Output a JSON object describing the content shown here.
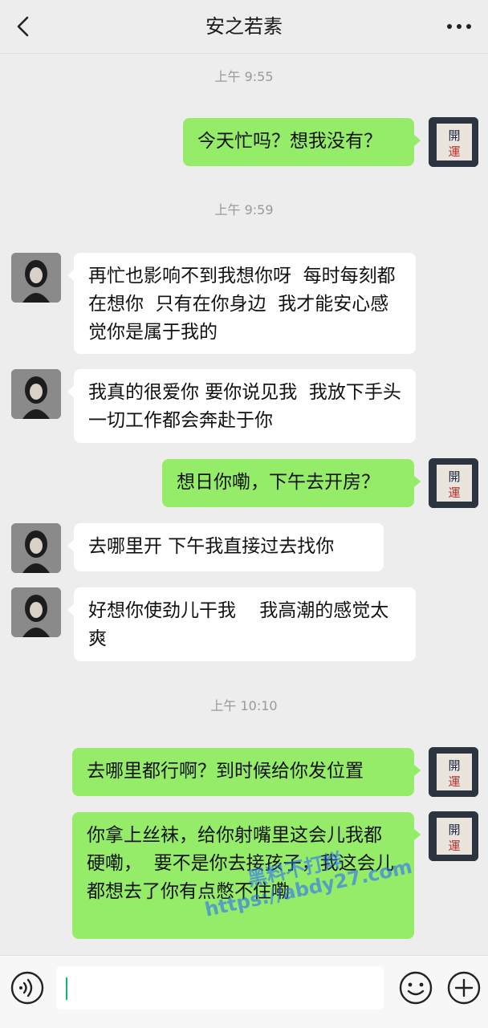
{
  "header": {
    "title": "安之若素",
    "back_icon": "chevron-left-icon",
    "more_icon": "more-dots-icon"
  },
  "messages": [
    {
      "type": "time",
      "text": "上午 9:55"
    },
    {
      "type": "msg",
      "side": "right",
      "text": "今天忙吗？想我没有？"
    },
    {
      "type": "time",
      "text": "上午 9:59"
    },
    {
      "type": "msg",
      "side": "left",
      "text": "再忙也影响不到我想你呀  每时每刻都在想你  只有在你身边  我才能安心感觉你是属于我的"
    },
    {
      "type": "msg",
      "side": "left",
      "text": "我真的很爱你 要你说见我  我放下手头一切工作都会奔赴于你"
    },
    {
      "type": "msg",
      "side": "right",
      "text": "想日你嘞，下午去开房？"
    },
    {
      "type": "msg",
      "side": "left",
      "text": "去哪里开 下午我直接过去找你"
    },
    {
      "type": "msg",
      "side": "left",
      "text": "好想你使劲儿干我    我高潮的感觉太爽"
    },
    {
      "type": "time",
      "text": "上午 10:10"
    },
    {
      "type": "msg",
      "side": "right",
      "text": "去哪里都行啊？到时候给你发位置"
    },
    {
      "type": "msg",
      "side": "right",
      "text": "你拿上丝袜，给你射嘴里这会儿我都硬嘞，  要不是你去接孩子，我这会儿都想去了你有点憋不住嘞"
    }
  ],
  "watermark": {
    "line1": "黑料不打烊",
    "line2": "https://abdy27.com"
  },
  "input": {
    "value": "",
    "voice_icon": "voice-icon",
    "emoji_icon": "emoji-icon",
    "plus_icon": "plus-icon"
  },
  "avatars": {
    "contact": "contact-avatar",
    "self_label": "開運"
  },
  "colors": {
    "self_bubble": "#95ec69",
    "other_bubble": "#ffffff",
    "background": "#ededed"
  }
}
